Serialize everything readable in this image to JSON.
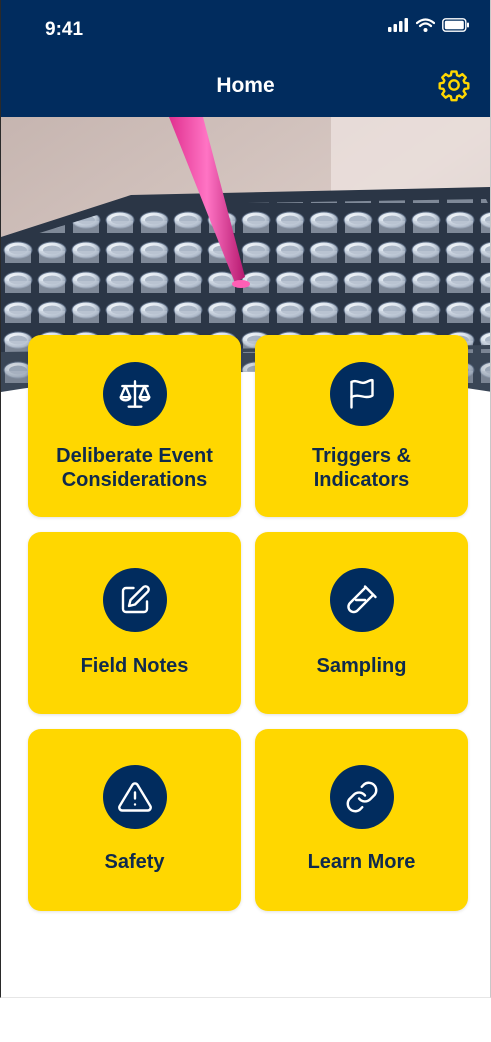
{
  "status_bar": {
    "time": "9:41"
  },
  "header": {
    "title": "Home"
  },
  "tiles": [
    {
      "label_line1": "Deliberate Event",
      "label_line2": "Considerations",
      "icon": "scales-icon"
    },
    {
      "label_line1": "Triggers &",
      "label_line2": "Indicators",
      "icon": "flag-icon"
    },
    {
      "label": "Field Notes",
      "icon": "edit-icon"
    },
    {
      "label": "Sampling",
      "icon": "test-tube-icon"
    },
    {
      "label": "Safety",
      "icon": "warning-icon"
    },
    {
      "label": "Learn More",
      "icon": "link-icon"
    }
  ],
  "colors": {
    "navy": "#012c5e",
    "yellow": "#ffd700",
    "label_text": "#0f2a4d"
  }
}
